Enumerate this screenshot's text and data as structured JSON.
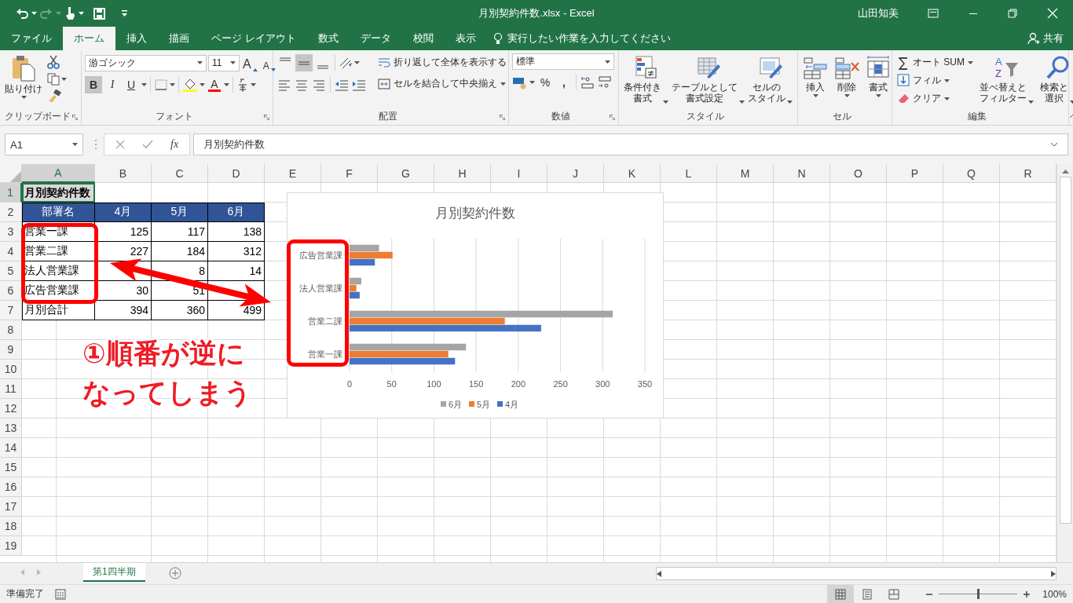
{
  "window": {
    "title": "月別契約件数.xlsx - Excel",
    "user": "山田知美"
  },
  "ribbon_tabs": [
    {
      "label": "ファイル",
      "selected": false
    },
    {
      "label": "ホーム",
      "selected": true
    },
    {
      "label": "挿入",
      "selected": false
    },
    {
      "label": "描画",
      "selected": false
    },
    {
      "label": "ページ レイアウト",
      "selected": false
    },
    {
      "label": "数式",
      "selected": false
    },
    {
      "label": "データ",
      "selected": false
    },
    {
      "label": "校閲",
      "selected": false
    },
    {
      "label": "表示",
      "selected": false
    }
  ],
  "tell_me": "実行したい作業を入力してください",
  "share": "共有",
  "ribbon": {
    "clipboard": {
      "label": "クリップボード",
      "paste": "貼り付け"
    },
    "font": {
      "label": "フォント",
      "font_name": "游ゴシック",
      "font_size": "11",
      "grow_font": "A",
      "shrink_font": "A",
      "font_color": "A",
      "styles": [
        {
          "kind": "bold",
          "text": "B",
          "pressed": true
        },
        {
          "kind": "italic",
          "text": "I",
          "pressed": false
        },
        {
          "kind": "underline",
          "text": "U",
          "pressed": false
        }
      ]
    },
    "alignment": {
      "label": "配置",
      "vertical": [
        {
          "pressed": false
        },
        {
          "pressed": true
        },
        {
          "pressed": false
        }
      ],
      "wrap": "折り返して全体を表示する",
      "merge": "セルを結合して中央揃え"
    },
    "number": {
      "label": "数値",
      "format": "標準",
      "percent": "%",
      "comma": ","
    },
    "styles": {
      "label": "スタイル",
      "buttons": [
        {
          "kind": "conditional",
          "lines": [
            "条件付き",
            "書式"
          ]
        },
        {
          "kind": "table",
          "lines": [
            "テーブルとして",
            "書式設定"
          ]
        },
        {
          "kind": "cellstyle",
          "lines": [
            "セルの",
            "スタイル"
          ]
        }
      ]
    },
    "cells": {
      "label": "セル",
      "buttons": [
        {
          "kind": "insert",
          "label": "挿入"
        },
        {
          "kind": "delete",
          "label": "削除"
        },
        {
          "kind": "format",
          "label": "書式"
        }
      ]
    },
    "editing": {
      "label": "編集",
      "small": [
        {
          "kind": "sum",
          "label": "オート SUM"
        },
        {
          "kind": "fill",
          "label": "フィル"
        },
        {
          "kind": "clear",
          "label": "クリア"
        }
      ],
      "big": [
        {
          "kind": "sort",
          "icon_letters": [
            "A",
            "Z"
          ],
          "lines": [
            "並べ替えと",
            "フィルター"
          ]
        },
        {
          "kind": "find",
          "lines": [
            "検索と",
            "選択"
          ]
        }
      ]
    }
  },
  "formula_bar": {
    "name_box": "A1",
    "fx": "fx",
    "value": "月別契約件数"
  },
  "columns": [
    {
      "label": "A",
      "selected": true
    },
    {
      "label": "B",
      "selected": false
    },
    {
      "label": "C",
      "selected": false
    },
    {
      "label": "D",
      "selected": false
    },
    {
      "label": "E",
      "selected": false
    },
    {
      "label": "F",
      "selected": false
    },
    {
      "label": "G",
      "selected": false
    },
    {
      "label": "H",
      "selected": false
    },
    {
      "label": "I",
      "selected": false
    },
    {
      "label": "J",
      "selected": false
    },
    {
      "label": "K",
      "selected": false
    },
    {
      "label": "L",
      "selected": false
    },
    {
      "label": "M",
      "selected": false
    },
    {
      "label": "N",
      "selected": false
    },
    {
      "label": "O",
      "selected": false
    },
    {
      "label": "P",
      "selected": false
    },
    {
      "label": "Q",
      "selected": false
    },
    {
      "label": "R",
      "selected": false
    }
  ],
  "rows": [
    {
      "number": "1",
      "selected": true,
      "cells": [
        {
          "kind": "title",
          "text": "月別契約件数"
        }
      ]
    },
    {
      "number": "2",
      "selected": false,
      "cells": [
        {
          "kind": "header",
          "text": "部署名"
        },
        {
          "kind": "header",
          "text": "4月"
        },
        {
          "kind": "header",
          "text": "5月"
        },
        {
          "kind": "header",
          "text": "6月"
        }
      ]
    },
    {
      "number": "3",
      "selected": false,
      "cells": [
        {
          "kind": "label",
          "text": "営業一課"
        },
        {
          "kind": "number",
          "text": "125"
        },
        {
          "kind": "number",
          "text": "117"
        },
        {
          "kind": "number",
          "text": "138"
        }
      ]
    },
    {
      "number": "4",
      "selected": false,
      "cells": [
        {
          "kind": "label",
          "text": "営業二課"
        },
        {
          "kind": "number",
          "text": "227"
        },
        {
          "kind": "number",
          "text": "184"
        },
        {
          "kind": "number",
          "text": "312"
        }
      ]
    },
    {
      "number": "5",
      "selected": false,
      "cells": [
        {
          "kind": "label",
          "text": "法人営業課"
        },
        {
          "kind": "covered"
        },
        {
          "kind": "number",
          "text": "8"
        },
        {
          "kind": "number",
          "text": "14"
        }
      ]
    },
    {
      "number": "6",
      "selected": false,
      "cells": [
        {
          "kind": "label",
          "text": "広告営業課"
        },
        {
          "kind": "number",
          "text": "30"
        },
        {
          "kind": "number",
          "text": "51"
        },
        {
          "kind": "covered"
        }
      ]
    },
    {
      "number": "7",
      "selected": false,
      "cells": [
        {
          "kind": "label",
          "text": "月別合計"
        },
        {
          "kind": "number",
          "text": "394"
        },
        {
          "kind": "number",
          "text": "360"
        },
        {
          "kind": "number",
          "text": "499"
        }
      ]
    },
    {
      "number": "8",
      "selected": false
    },
    {
      "number": "9",
      "selected": false
    },
    {
      "number": "10",
      "selected": false
    },
    {
      "number": "11",
      "selected": false
    },
    {
      "number": "12",
      "selected": false
    },
    {
      "number": "13",
      "selected": false
    },
    {
      "number": "14",
      "selected": false
    },
    {
      "number": "15",
      "selected": false
    },
    {
      "number": "16",
      "selected": false
    },
    {
      "number": "17",
      "selected": false
    },
    {
      "number": "18",
      "selected": false
    },
    {
      "number": "19",
      "selected": false
    }
  ],
  "chart": {
    "chart_data": {
      "type": "bar",
      "orientation": "horizontal",
      "title": "月別契約件数",
      "categories": [
        "広告営業課",
        "法人営業課",
        "営業二課",
        "営業一課"
      ],
      "series": [
        {
          "name": "4月",
          "color": "#4472c4",
          "values": [
            30,
            12,
            227,
            125
          ]
        },
        {
          "name": "5月",
          "color": "#ed7d31",
          "values": [
            51,
            8,
            184,
            117
          ]
        },
        {
          "name": "6月",
          "color": "#a5a5a5",
          "values": [
            35,
            14,
            312,
            138
          ]
        }
      ],
      "xlim": [
        0,
        350
      ],
      "xticks": [
        0,
        50,
        100,
        150,
        200,
        250,
        300,
        350
      ],
      "grid": true,
      "legend": true
    }
  },
  "annotation": {
    "lines": [
      "①順番が逆に",
      "なってしまう"
    ]
  },
  "sheet_tabs": [
    {
      "label": "第1四半期",
      "selected": true
    }
  ],
  "status_bar": {
    "status": "準備完了",
    "views": [
      {
        "kind": "normal",
        "selected": true
      },
      {
        "kind": "layout",
        "selected": false
      },
      {
        "kind": "pagebreak",
        "selected": false
      }
    ],
    "zoom": {
      "level": 0.5
    },
    "zoom_text": "100%"
  }
}
